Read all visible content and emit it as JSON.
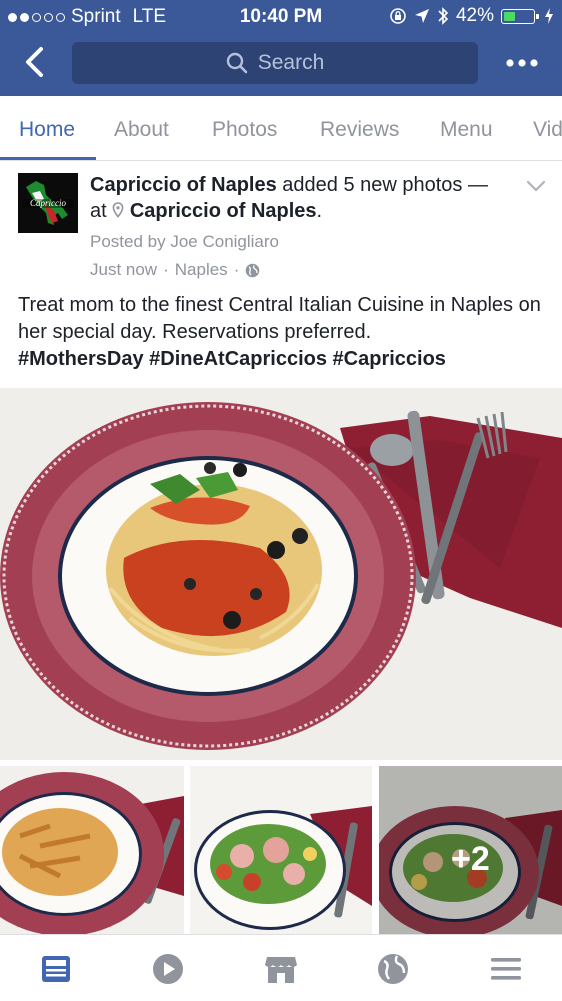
{
  "status_bar": {
    "carrier": "Sprint",
    "network": "LTE",
    "time": "10:40 PM",
    "battery_percent": "42%",
    "battery_level": 0.42,
    "signal_bars": 2
  },
  "header": {
    "search_placeholder": "Search",
    "background_color": "#3b5998"
  },
  "tabs": [
    {
      "label": "Home",
      "active": true
    },
    {
      "label": "About"
    },
    {
      "label": "Photos"
    },
    {
      "label": "Reviews"
    },
    {
      "label": "Menu"
    },
    {
      "label": "Vid"
    }
  ],
  "post": {
    "page_name": "Capriccio of Naples",
    "action_text": "added 5 new photos",
    "at_prefix": "— at",
    "location_name": "Capriccio of Naples",
    "posted_by": "Posted by Joe Conigliaro",
    "timestamp": "Just now",
    "place": "Naples",
    "body": "Treat mom to the finest Central Italian Cuisine in Naples on her special day. Reservations preferred.",
    "hashtags": "#MothersDay #DineAtCapriccios #Capriccios",
    "more_photos": "+2"
  },
  "avatar": {
    "logo_text": "Capriccio"
  },
  "bottom_nav": [
    {
      "icon": "news-feed-icon",
      "active": true
    },
    {
      "icon": "video-play-icon"
    },
    {
      "icon": "marketplace-icon"
    },
    {
      "icon": "globe-notifications-icon"
    },
    {
      "icon": "menu-icon"
    }
  ],
  "colors": {
    "accent": "#4267b2",
    "muted_text": "#90949c",
    "plate_rim": "#a33f52",
    "napkin": "#8e1f33"
  }
}
